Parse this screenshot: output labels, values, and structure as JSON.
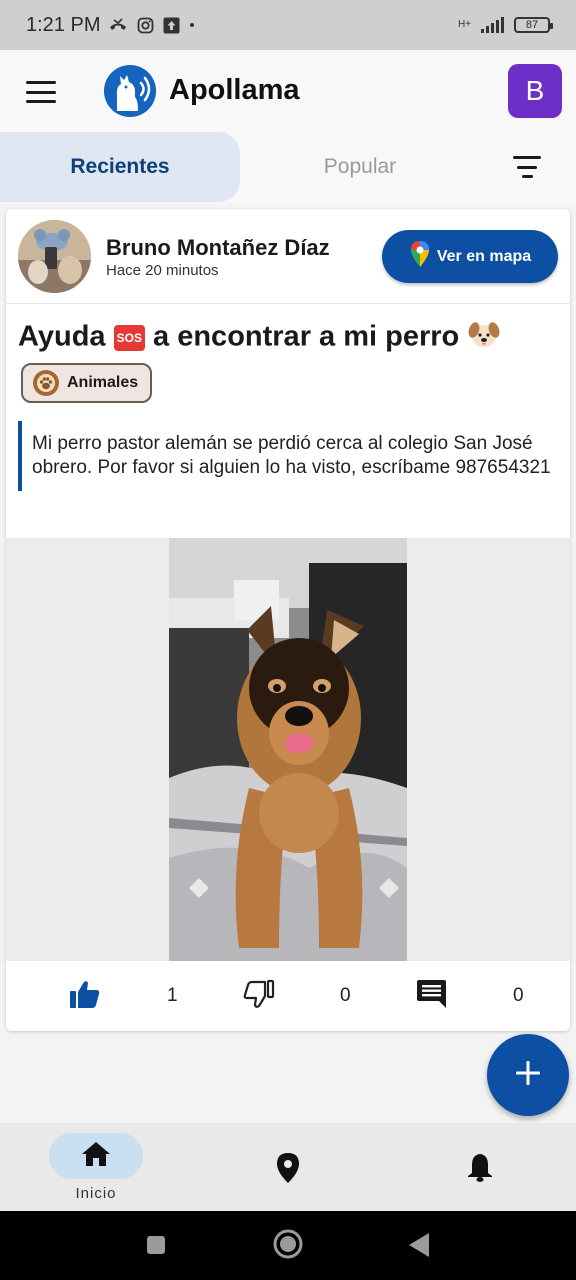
{
  "status_bar": {
    "time": "1:21 PM",
    "network": "H+",
    "battery": "87",
    "icons": [
      "missed-call-icon",
      "instagram-icon",
      "upload-icon",
      "dot-icon",
      "signal-icon",
      "battery-icon"
    ]
  },
  "app_bar": {
    "title": "Apollama",
    "avatar_letter": "B",
    "avatar_color": "#6d2fc8"
  },
  "tabs": {
    "recent": "Recientes",
    "popular": "Popular"
  },
  "post": {
    "author": "Bruno Montañez Díaz",
    "time_ago": "Hace 20 minutos",
    "map_button": "Ver en mapa",
    "title_start": "Ayuda",
    "title_sos": "SOS",
    "title_end": "a encontrar a mi perro",
    "category": "Animales",
    "description": "Mi perro pastor alemán se perdió cerca al colegio San José obrero. Por favor si alguien lo ha visto, escríbame 987654321",
    "likes": "1",
    "dislikes": "0",
    "comments": "0"
  },
  "bottom_nav": {
    "home_label": "Inicio"
  },
  "colors": {
    "primary": "#0d4fa3",
    "active_tab_bg": "#dde6f1",
    "active_tab_text": "#0f3e78",
    "chip_border": "#6b5d54",
    "home_pill": "#cbdff3"
  }
}
